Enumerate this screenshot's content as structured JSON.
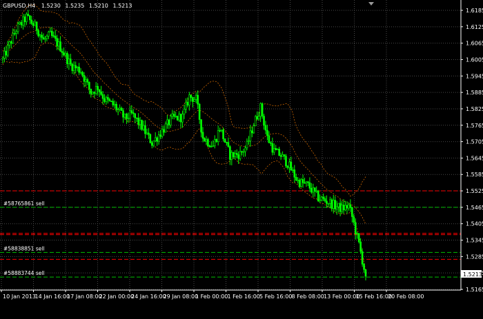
{
  "chart_data": {
    "type": "candlestick",
    "header": {
      "symbol": "GBPUSD,H4",
      "open": "1.5230",
      "high": "1.5235",
      "low": "1.5210",
      "close": "1.5213"
    },
    "current_price": "1.5213",
    "ylim": [
      1.5145,
      1.6215
    ],
    "grid": true,
    "y_ticks": [
      "1.6185",
      "1.6125",
      "1.6065",
      "1.6005",
      "1.5945",
      "1.5885",
      "1.5825",
      "1.5765",
      "1.5705",
      "1.5645",
      "1.5585",
      "1.5525",
      "1.5465",
      "1.5405",
      "1.5345",
      "1.5285",
      "1.5225",
      "1.5165"
    ],
    "x_ticks": [
      "10 Jan 2013",
      "14 Jan 16:00",
      "17 Jan 08:00",
      "22 Jan 00:00",
      "24 Jan 16:00",
      "29 Jan 08:00",
      "1 Feb 00:00",
      "1 Feb 16:00",
      "5 Feb 16:00",
      "8 Feb 08:00",
      "13 Feb 00:00",
      "15 Feb 16:00",
      "20 Feb 08:00"
    ],
    "price_path": [
      [
        0,
        1.6005
      ],
      [
        4,
        1.6115
      ],
      [
        7,
        1.616
      ],
      [
        10,
        1.612
      ],
      [
        12,
        1.6075
      ],
      [
        14,
        1.6095
      ],
      [
        17,
        1.605
      ],
      [
        20,
        1.5985
      ],
      [
        23,
        1.5965
      ],
      [
        26,
        1.5885
      ],
      [
        28,
        1.5905
      ],
      [
        30,
        1.586
      ],
      [
        33,
        1.5835
      ],
      [
        36,
        1.579
      ],
      [
        38,
        1.5805
      ],
      [
        41,
        1.576
      ],
      [
        44,
        1.57
      ],
      [
        47,
        1.5745
      ],
      [
        50,
        1.579
      ],
      [
        53,
        1.5795
      ],
      [
        55,
        1.587
      ],
      [
        57,
        1.586
      ],
      [
        59,
        1.572
      ],
      [
        62,
        1.569
      ],
      [
        64,
        1.5755
      ],
      [
        67,
        1.5655
      ],
      [
        70,
        1.566
      ],
      [
        72,
        1.569
      ],
      [
        74,
        1.577
      ],
      [
        76,
        1.583
      ],
      [
        78,
        1.572
      ],
      [
        80,
        1.567
      ],
      [
        82,
        1.5655
      ],
      [
        84,
        1.5625
      ],
      [
        87,
        1.556
      ],
      [
        90,
        1.5545
      ],
      [
        93,
        1.55
      ],
      [
        96,
        1.5485
      ],
      [
        98,
        1.547
      ],
      [
        100,
        1.546
      ],
      [
        102,
        1.547
      ],
      [
        103,
        1.543
      ],
      [
        105,
        1.533
      ],
      [
        107,
        1.5213
      ]
    ],
    "orders": [
      {
        "label": "#58765861 sell",
        "entry": 1.5465,
        "stop": 1.5525,
        "take": 1.5365
      },
      {
        "label": "#58838851 sell",
        "entry": 1.53,
        "stop": 1.537,
        "take": 1.5275
      },
      {
        "label": "#58883744 sell",
        "entry": 1.521,
        "stop": null,
        "take": null
      }
    ],
    "colors": {
      "background": "#000000",
      "grid": "#4a4a4a",
      "candle": "#00ff00",
      "envelope": "#cc6600",
      "entry_line": "#00c000",
      "stop_line": "#ff0000",
      "take_line": "#00c000",
      "text": "#ffffff"
    }
  }
}
